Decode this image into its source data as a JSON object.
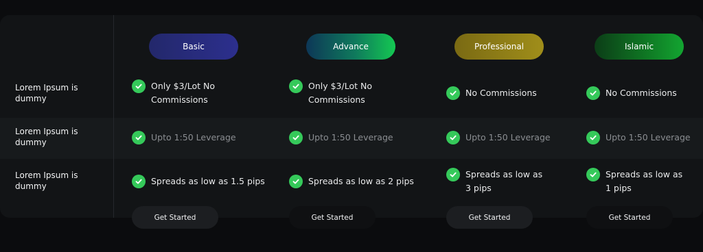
{
  "row_labels": [
    "Lorem Ipsum is dummy",
    "Lorem Ipsum is dummy",
    "Lorem Ipsum is dummy"
  ],
  "plans": [
    {
      "name": "Basic",
      "features": [
        "Only $3/Lot No Commissions",
        "Upto 1:50 Leverage",
        "Spreads as low as 1.5 pips"
      ],
      "cta": "Get Started"
    },
    {
      "name": "Advance",
      "features": [
        "Only $3/Lot No Commissions",
        "Upto 1:50 Leverage",
        "Spreads as low as 2 pips"
      ],
      "cta": "Get Started"
    },
    {
      "name": "Professional",
      "features": [
        "No Commissions",
        "Upto 1:50 Leverage",
        "Spreads as low as 3 pips"
      ],
      "cta": "Get Started"
    },
    {
      "name": "Islamic",
      "features": [
        "No Commissions",
        "Upto 1:50 Leverage",
        "Spreads as low as 1 pips"
      ],
      "cta": "Get Started"
    }
  ],
  "icons": {
    "feature": "check-circle-icon"
  },
  "colors": {
    "check": "#35c95a",
    "background": "#0b0c0e",
    "panel": "#121416"
  }
}
